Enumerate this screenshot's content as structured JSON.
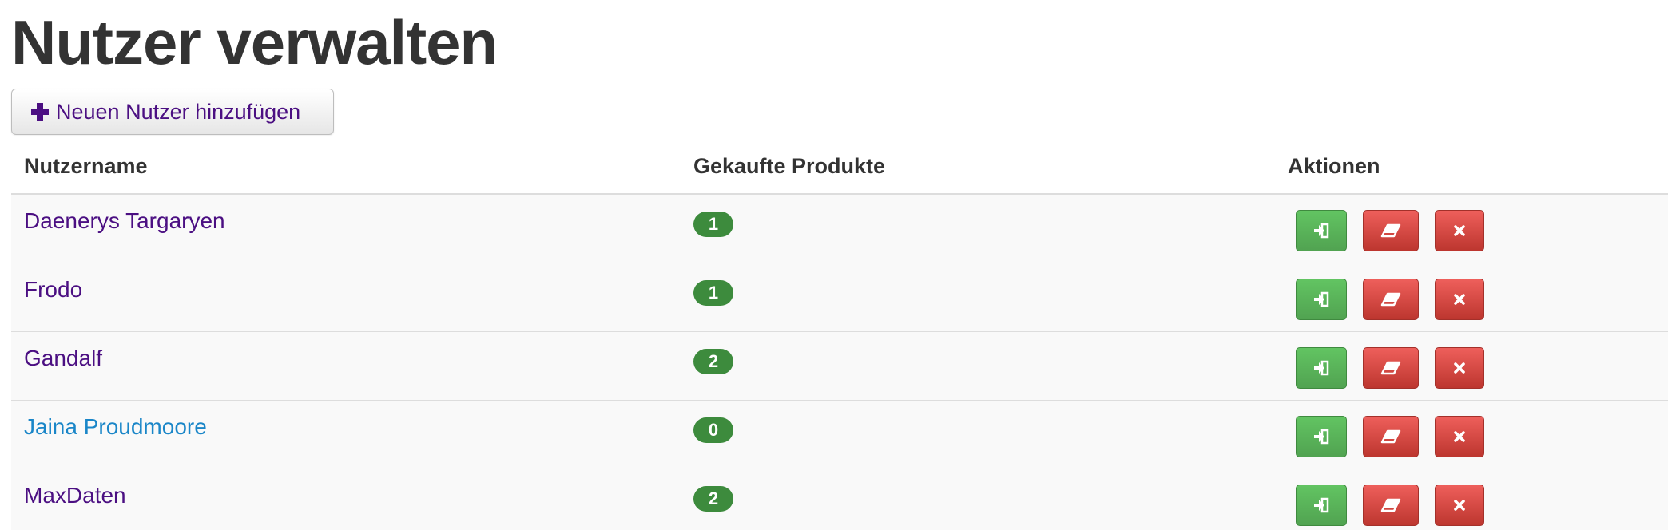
{
  "page": {
    "title": "Nutzer verwalten",
    "add_button_label": "Neuen Nutzer hinzufügen"
  },
  "table": {
    "headers": {
      "username": "Nutzername",
      "products": "Gekaufte Produkte",
      "actions": "Aktionen"
    },
    "rows": [
      {
        "name": "Daenerys Targaryen",
        "products": "1",
        "visited": true
      },
      {
        "name": "Frodo",
        "products": "1",
        "visited": true
      },
      {
        "name": "Gandalf",
        "products": "2",
        "visited": true
      },
      {
        "name": "Jaina Proudmoore",
        "products": "0",
        "visited": false
      },
      {
        "name": "MaxDaten",
        "products": "2",
        "visited": true
      }
    ],
    "row_actions": [
      {
        "icon": "login-icon",
        "color": "#5bb75b"
      },
      {
        "icon": "eraser-icon",
        "color": "#da4f49"
      },
      {
        "icon": "close-icon",
        "color": "#da4f49"
      }
    ]
  },
  "colors": {
    "visited_link": "#4b0f82",
    "link": "#1a86c8",
    "badge_success": "#3d8b3d",
    "button_success": "#5bb75b",
    "button_danger": "#da4f49"
  }
}
